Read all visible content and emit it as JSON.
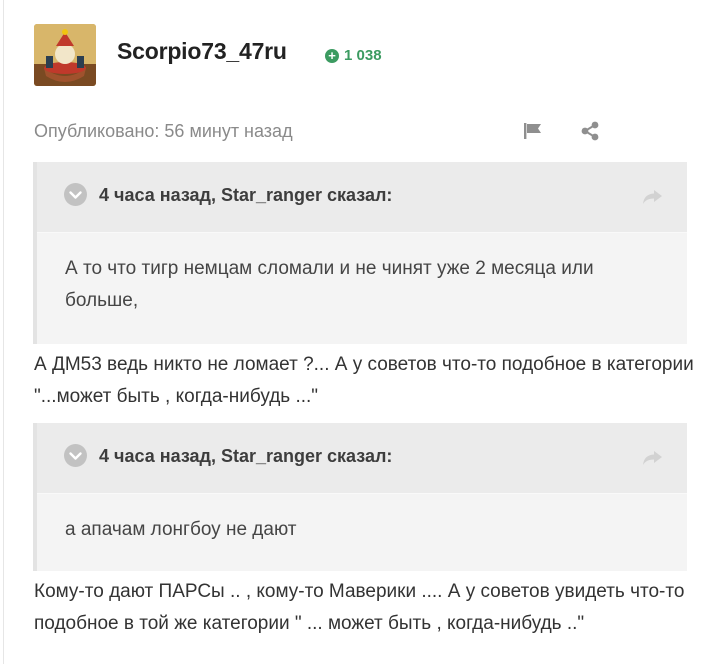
{
  "author": {
    "name": "Scorpio73_47ru",
    "reputation": "1 038",
    "reputation_icon": "plus-circle-icon"
  },
  "post": {
    "published": "Опубликовано: 56 минут назад",
    "report_icon": "flag-icon",
    "share_icon": "share-icon"
  },
  "quotes": [
    {
      "citation": "4 часа назад, Star_ranger сказал:",
      "text": "А то что тигр немцам сломали и не чинят уже 2 месяца или больше,"
    },
    {
      "citation": "4 часа назад, Star_ranger сказал:",
      "text": "а апачам лонгбоу не дают"
    }
  ],
  "paragraphs": [
    "А ДМ53 ведь никто не ломает ?... А у советов что-то подобное в категории \"...может быть , когда-нибудь ...\"",
    "Кому-то дают ПАРСы .. , кому-то Маверики .... А у советов увидеть что-то подобное в той же категории \" ... может быть , когда-нибудь ..\""
  ],
  "colors": {
    "reputation": "#3c9b61",
    "quote_bg": "#f4f4f4",
    "quote_header_bg": "#ebebeb",
    "muted_text": "#8a8a8a"
  }
}
